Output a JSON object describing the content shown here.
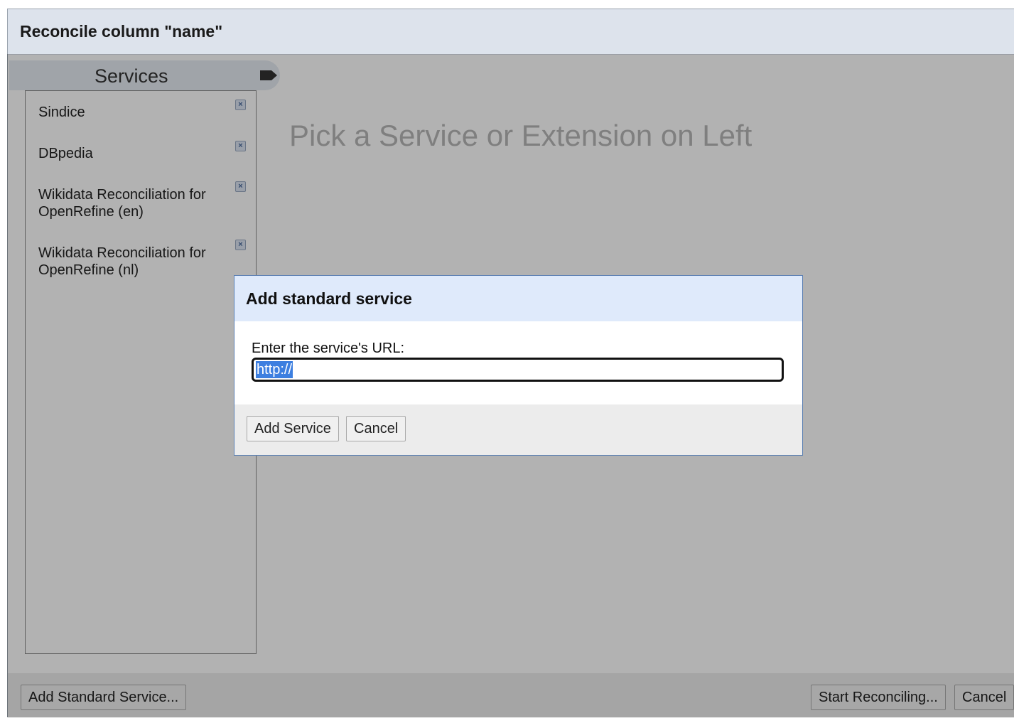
{
  "dialog": {
    "title": "Reconcile column \"name\"",
    "services_tab_label": "Services",
    "services": [
      {
        "line1": "Sindice",
        "line2": ""
      },
      {
        "line1": "DBpedia",
        "line2": ""
      },
      {
        "line1": "Wikidata Reconciliation for",
        "line2": "OpenRefine (en)"
      },
      {
        "line1": "Wikidata Reconciliation for",
        "line2": "OpenRefine (nl)"
      }
    ],
    "placeholder_message": "Pick a Service or Extension on Left",
    "footer": {
      "add_standard_service_label": "Add Standard Service...",
      "start_reconciling_label": "Start Reconciling...",
      "cancel_label": "Cancel"
    }
  },
  "modal": {
    "title": "Add standard service",
    "url_label": "Enter the service's URL:",
    "url_value": "http://",
    "add_service_label": "Add Service",
    "cancel_label": "Cancel"
  },
  "icons": {
    "tag": "tag-icon",
    "remove": "remove-service-icon"
  },
  "colors": {
    "header_bg": "#dde3ec",
    "modal_header_bg": "#dfeafb",
    "selection": "#3d7fe0",
    "overlay": "rgba(0,0,0,0.30)"
  }
}
